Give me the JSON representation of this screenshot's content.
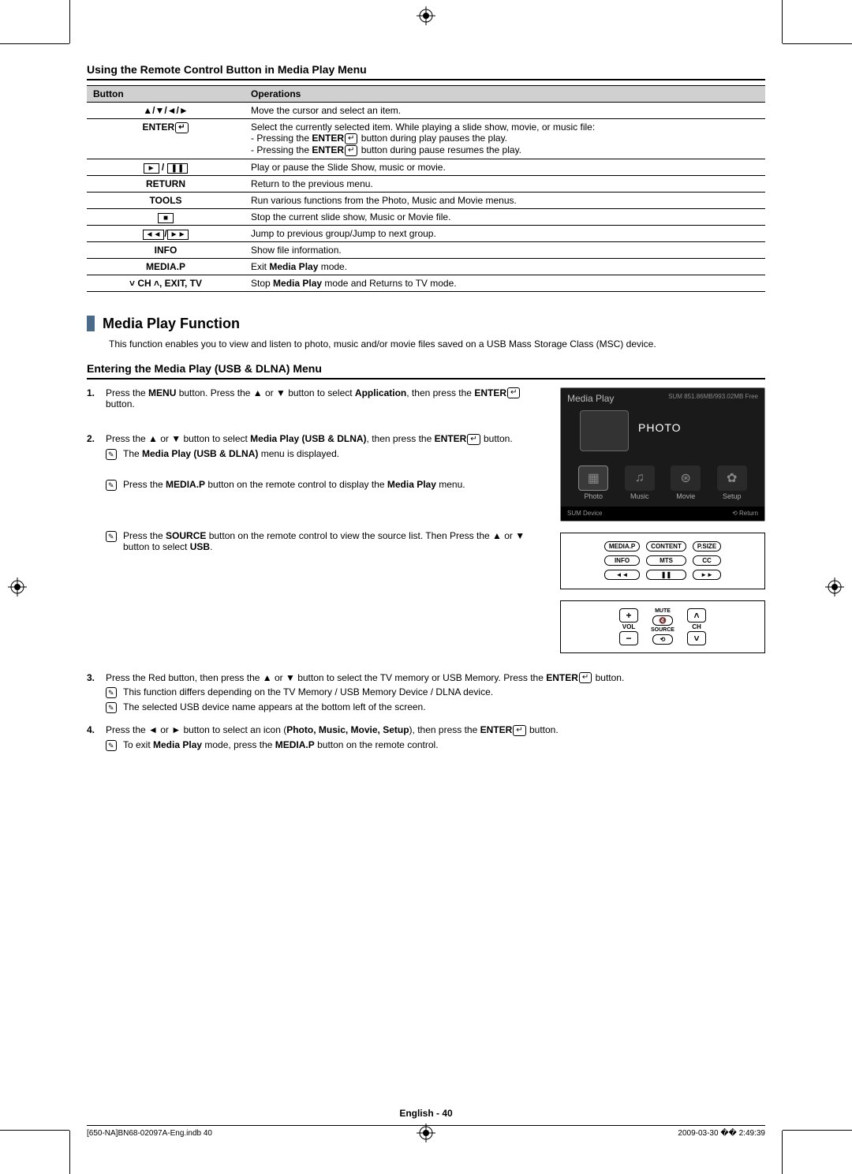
{
  "heading_remote": "Using the Remote Control Button in Media Play Menu",
  "table": {
    "h1": "Button",
    "h2": "Operations",
    "rows": [
      {
        "b": "▲/▼/◄/►",
        "o": "Move the cursor and select an item."
      },
      {
        "b": "ENTER",
        "o": "Select the currently selected item. While playing a slide show, movie, or music file:\n- Pressing the ENTER button during play pauses the play.\n- Pressing the ENTER button during pause resumes the play."
      },
      {
        "b": "►/❚❚",
        "o": "Play or pause the Slide Show, music or movie."
      },
      {
        "b": "RETURN",
        "o": "Return to the previous menu."
      },
      {
        "b": "TOOLS",
        "o": "Run various functions from the Photo, Music and Movie menus."
      },
      {
        "b": "■",
        "o": "Stop the current slide show, Music or Movie file."
      },
      {
        "b": "◄◄/►►",
        "o": "Jump to previous group/Jump to next group."
      },
      {
        "b": "INFO",
        "o": "Show file information."
      },
      {
        "b": "MEDIA.P",
        "o": "Exit Media Play mode."
      },
      {
        "b": "˅ CH ˄, EXIT, TV",
        "o": "Stop Media Play mode and Returns to TV mode."
      }
    ]
  },
  "section_title": "Media Play Function",
  "section_desc": "This function enables you to view and listen to photo, music and/or movie files saved on a USB Mass Storage Class (MSC) device.",
  "sub_heading": "Entering the Media Play (USB & DLNA) Menu",
  "steps": {
    "s1": {
      "num": "1.",
      "text": "Press the MENU button. Press the ▲ or ▼ button to select Application, then press the ENTER button."
    },
    "s2": {
      "num": "2.",
      "text": "Press the ▲ or ▼ button to select Media Play (USB & DLNA), then press the ENTER button.",
      "note1": "The Media Play (USB & DLNA) menu is displayed.",
      "note2": "Press the MEDIA.P button on the remote control to display the Media Play menu.",
      "note3": "Press the SOURCE button on the remote control to view the source list. Then Press the ▲ or ▼ button to select USB."
    },
    "s3": {
      "num": "3.",
      "text": "Press the Red button, then press the ▲ or ▼ button to select the TV memory or USB Memory. Press the ENTER button.",
      "note1": "This function differs depending on the TV Memory / USB Memory Device / DLNA device.",
      "note2": "The selected USB device name appears at the bottom left of the screen."
    },
    "s4": {
      "num": "4.",
      "text": "Press the ◄ or ► button to select an icon (Photo, Music, Movie, Setup), then press the ENTER button.",
      "note1": "To exit Media Play mode, press the MEDIA.P button on the remote control."
    }
  },
  "osd": {
    "title": "Media Play",
    "sum": "SUM    851.86MB/993.02MB Free",
    "photo": "PHOTO",
    "items": [
      "Photo",
      "Music",
      "Movie",
      "Setup"
    ],
    "bot_left": "SUM   Device",
    "bot_right": "⟲ Return"
  },
  "remote1": {
    "r": [
      "MEDIA.P",
      "CONTENT",
      "P.SIZE",
      "INFO",
      "MTS",
      "CC",
      "◄◄",
      "❚❚",
      "►►"
    ]
  },
  "remote2": {
    "vol": "VOL",
    "ch": "CH",
    "mute": "MUTE",
    "source": "SOURCE"
  },
  "page_label": "English - 40",
  "footer_left": "[650-NA]BN68-02097A-Eng.indb   40",
  "footer_right": "2009-03-30   �� 2:49:39"
}
